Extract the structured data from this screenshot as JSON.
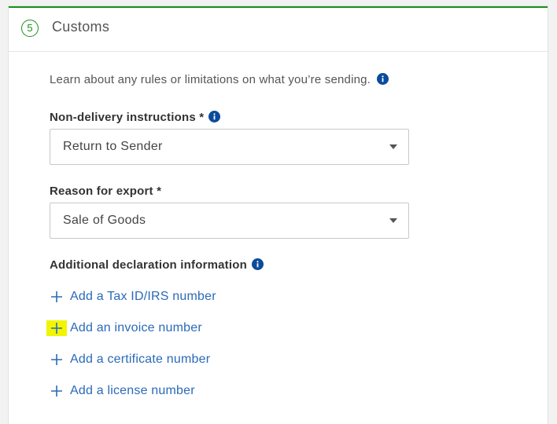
{
  "section": {
    "step_number": "5",
    "title": "Customs"
  },
  "learn_text": "Learn about any rules or limitations on what you’re sending.",
  "non_delivery": {
    "label": "Non-delivery instructions *",
    "selected": "Return to Sender"
  },
  "reason_export": {
    "label": "Reason for export *",
    "selected": "Sale of Goods"
  },
  "additional": {
    "label": "Additional declaration information",
    "links": [
      {
        "label": "Add a Tax ID/IRS number"
      },
      {
        "label": "Add an invoice number"
      },
      {
        "label": "Add a certificate number"
      },
      {
        "label": "Add a license number"
      }
    ]
  },
  "colors": {
    "accent_green": "#1a8f1a",
    "link_blue": "#2a6ab8",
    "info_blue": "#0b4b9c",
    "highlight_yellow": "#f2f500"
  },
  "icons": {
    "info": "info-icon",
    "plus": "plus-icon",
    "dropdown": "chevron-down-icon"
  }
}
